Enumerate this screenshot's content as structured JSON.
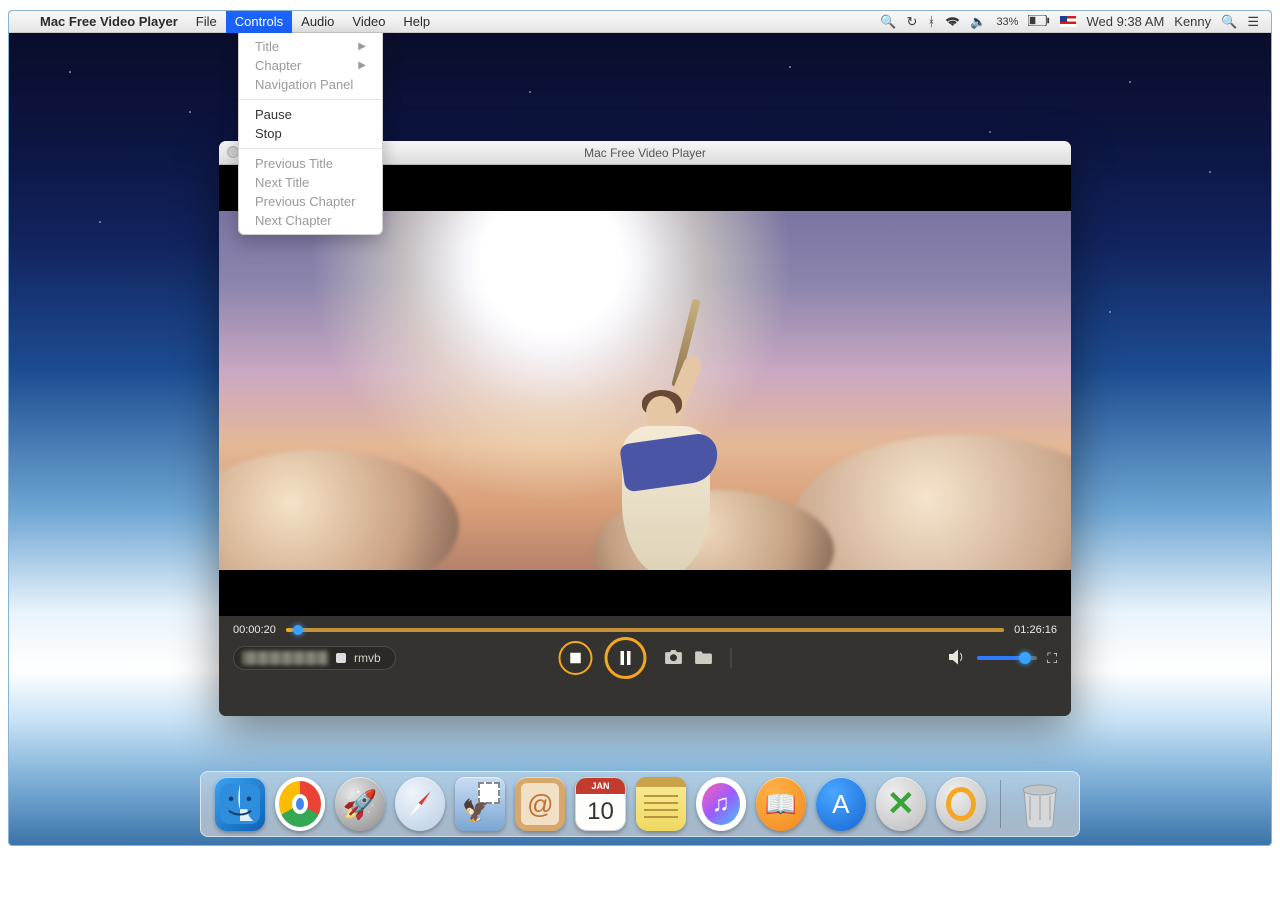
{
  "menubar": {
    "app_name": "Mac Free Video Player",
    "items": [
      "File",
      "Controls",
      "Audio",
      "Video",
      "Help"
    ],
    "active_index": 1,
    "right": {
      "battery_percent": "33%",
      "clock": "Wed 9:38 AM",
      "user": "Kenny"
    }
  },
  "dropdown": {
    "groups": [
      [
        {
          "label": "Title",
          "submenu": true,
          "enabled": false
        },
        {
          "label": "Chapter",
          "submenu": true,
          "enabled": false
        },
        {
          "label": "Navigation Panel",
          "enabled": false
        }
      ],
      [
        {
          "label": "Pause",
          "enabled": true
        },
        {
          "label": "Stop",
          "enabled": true
        }
      ],
      [
        {
          "label": "Previous Title",
          "enabled": false
        },
        {
          "label": "Next Title",
          "enabled": false
        },
        {
          "label": "Previous Chapter",
          "enabled": false
        },
        {
          "label": "Next Chapter",
          "enabled": false
        }
      ]
    ]
  },
  "window": {
    "title": "Mac Free Video Player"
  },
  "player": {
    "elapsed": "00:00:20",
    "total": "01:26:16",
    "progress_percent": 1,
    "file_ext": "rmvb",
    "volume_percent": 70
  },
  "dock": {
    "cal_month": "JAN",
    "cal_day": "10",
    "items": [
      "finder",
      "chrome",
      "launchpad",
      "safari",
      "mail",
      "contacts",
      "calendar",
      "notes",
      "itunes",
      "ibooks",
      "appstore",
      "excel-x",
      "orange-ring",
      "trash"
    ]
  }
}
